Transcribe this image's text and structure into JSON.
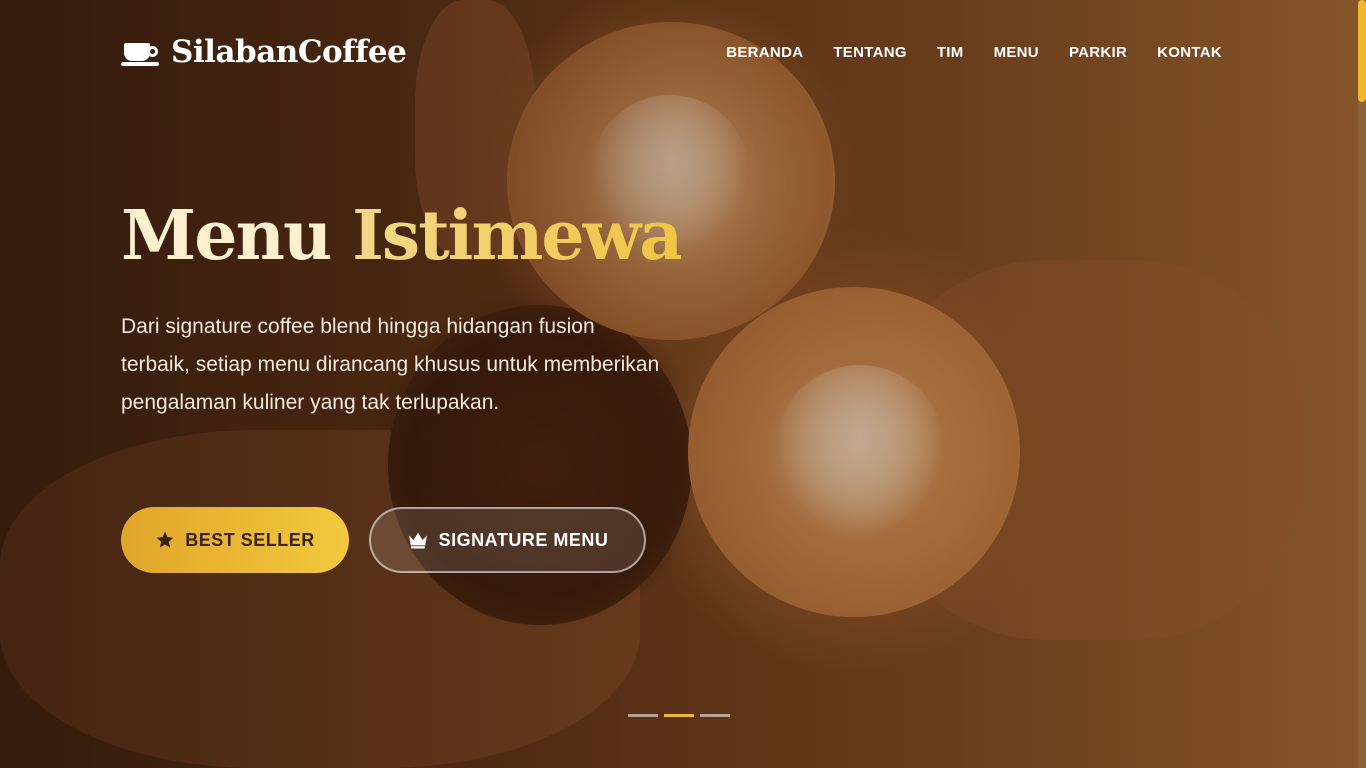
{
  "brand": {
    "name": "SilabanCoffee",
    "icon": "coffee-cup-icon"
  },
  "nav": {
    "items": [
      {
        "label": "BERANDA"
      },
      {
        "label": "TENTANG"
      },
      {
        "label": "TIM"
      },
      {
        "label": "MENU"
      },
      {
        "label": "PARKIR"
      },
      {
        "label": "KONTAK"
      }
    ]
  },
  "hero": {
    "title_part1": "Menu",
    "title_part2": "Istimewa",
    "description": "Dari signature coffee blend hingga hidangan fusion terbaik, setiap menu dirancang khusus untuk memberikan pengalaman kuliner yang tak terlupakan.",
    "primary_button": {
      "label": "BEST SELLER",
      "icon": "star-icon"
    },
    "secondary_button": {
      "label": "SIGNATURE MENU",
      "icon": "crown-icon"
    },
    "slides": {
      "count": 3,
      "active_index": 1
    }
  },
  "colors": {
    "accent": "#f0b82c",
    "title_highlight": "#f3d88a",
    "button_primary_start": "#e1a52a",
    "button_primary_end": "#f3c93e",
    "text_light": "#ffffff"
  }
}
